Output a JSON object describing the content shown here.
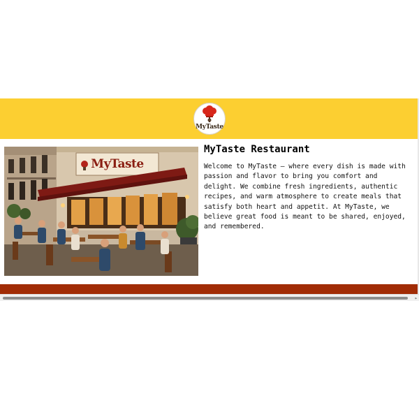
{
  "header": {
    "logo_text": "MyTaste",
    "logo_icon": "chef-hat-icon",
    "background_color": "#fccf31"
  },
  "hero": {
    "photo_icon": "restaurant-terrace-photo",
    "sign_text": "MyTaste",
    "title": "MyTaste Restaurant",
    "description": "Welcome to MyTaste – where every dish is made with passion and flavor to bring you comfort and delight. We combine fresh ingredients, authentic recipes, and warm atmosphere to create meals that satisfy both heart and appetit. At MyTaste, we believe great food is meant to be shared, enjoyed, and remembered."
  },
  "footer": {
    "background_color": "#a12c06",
    "accent_color": "#fccf31"
  },
  "scrollbar": {
    "arrow_icon": "scroll-right-arrow-icon"
  }
}
